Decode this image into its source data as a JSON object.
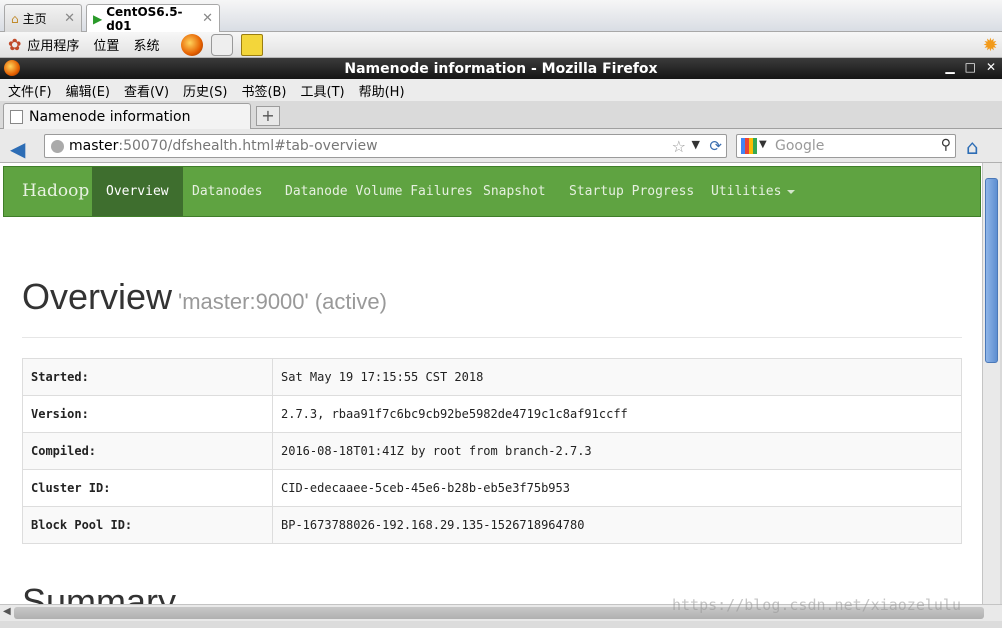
{
  "vm_tabs": [
    {
      "label": "主页",
      "active": false
    },
    {
      "label": "CentOS6.5-d01",
      "active": true
    }
  ],
  "gnome_panel": {
    "items": [
      "应用程序",
      "位置",
      "系统"
    ]
  },
  "window": {
    "title": "Namenode information - Mozilla Firefox"
  },
  "menubar": [
    "文件(F)",
    "编辑(E)",
    "查看(V)",
    "历史(S)",
    "书签(B)",
    "工具(T)",
    "帮助(H)"
  ],
  "tab": {
    "title": "Namenode information"
  },
  "urlbar": {
    "host": "master",
    "rest": ":50070/dfshealth.html#tab-overview"
  },
  "search": {
    "placeholder": "Google"
  },
  "nav": {
    "brand": "Hadoop",
    "items": [
      "Overview",
      "Datanodes",
      "Datanode Volume Failures",
      "Snapshot",
      "Startup Progress",
      "Utilities"
    ],
    "active": "Overview"
  },
  "header": {
    "title": "Overview",
    "subtitle": "'master:9000' (active)"
  },
  "info": [
    {
      "key": "Started:",
      "value": "Sat May 19 17:15:55 CST 2018"
    },
    {
      "key": "Version:",
      "value": "2.7.3, rbaa91f7c6bc9cb92be5982de4719c1c8af91ccff"
    },
    {
      "key": "Compiled:",
      "value": "2016-08-18T01:41Z by root from branch-2.7.3"
    },
    {
      "key": "Cluster ID:",
      "value": "CID-edecaaee-5ceb-45e6-b28b-eb5e3f75b953"
    },
    {
      "key": "Block Pool ID:",
      "value": "BP-1673788026-192.168.29.135-1526718964780"
    }
  ],
  "summary_title": "Summary",
  "watermark": "https://blog.csdn.net/xiaozelulu"
}
